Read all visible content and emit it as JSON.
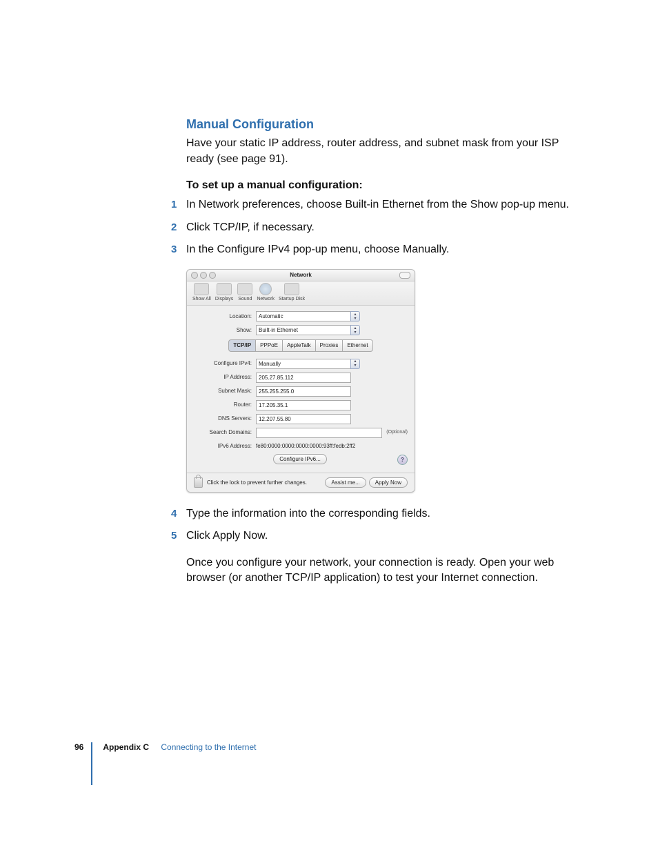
{
  "heading": "Manual Configuration",
  "intro": "Have your static IP address, router address, and subnet mask from your ISP ready (see page 91).",
  "sub_heading": "To set up a manual configuration:",
  "steps_a": [
    "In Network preferences, choose Built-in Ethernet from the Show pop-up menu.",
    "Click TCP/IP, if necessary.",
    "In the Configure IPv4 pop-up menu, choose Manually."
  ],
  "steps_b": [
    "Type the information into the corresponding fields.",
    "Click Apply Now."
  ],
  "outro": "Once you configure your network, your connection is ready. Open your web browser (or another TCP/IP application) to test your Internet connection.",
  "footer": {
    "page": "96",
    "appendix": "Appendix C",
    "title": "Connecting to the Internet"
  },
  "screenshot": {
    "title": "Network",
    "toolbar": [
      "Show All",
      "Displays",
      "Sound",
      "Network",
      "Startup Disk"
    ],
    "location_label": "Location:",
    "location_value": "Automatic",
    "show_label": "Show:",
    "show_value": "Built-in Ethernet",
    "tabs": [
      "TCP/IP",
      "PPPoE",
      "AppleTalk",
      "Proxies",
      "Ethernet"
    ],
    "active_tab": "TCP/IP",
    "config_label": "Configure IPv4:",
    "config_value": "Manually",
    "ip_label": "IP Address:",
    "ip_value": "205.27.85.112",
    "subnet_label": "Subnet Mask:",
    "subnet_value": "255.255.255.0",
    "router_label": "Router:",
    "router_value": "17.205.35.1",
    "dns_label": "DNS Servers:",
    "dns_value": "12.207.55.80",
    "search_label": "Search Domains:",
    "search_value": "",
    "optional": "(Optional)",
    "ipv6_label": "IPv6 Address:",
    "ipv6_value": "fe80:0000:0000:0000:0000:93ff:fedb:2ff2",
    "configure_ipv6_btn": "Configure IPv6...",
    "help": "?",
    "lock_text": "Click the lock to prevent further changes.",
    "assist_btn": "Assist me...",
    "apply_btn": "Apply Now"
  }
}
